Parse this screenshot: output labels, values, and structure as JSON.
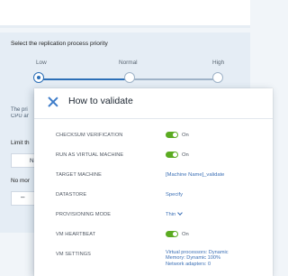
{
  "priority": {
    "title": "Select the replication process priority",
    "levels": [
      "Low",
      "Normal",
      "High"
    ],
    "selected": "Low"
  },
  "background": {
    "text_line1": "The pri",
    "text_line2": "CPU an",
    "limit_label": "Limit th",
    "field_value": "No",
    "no_more_label": "No mor",
    "stepper_symbol": "–"
  },
  "modal": {
    "title": "How to validate",
    "rows": {
      "checksum": {
        "label": "CHECKSUM VERIFICATION",
        "value": "On"
      },
      "run_vm": {
        "label": "RUN AS VIRTUAL MACHINE",
        "value": "On"
      },
      "target": {
        "label": "TARGET MACHINE",
        "value": "[Machine Name]_validate"
      },
      "datastore": {
        "label": "DATASTORE",
        "value": "Specify"
      },
      "provisioning": {
        "label": "PROVISIONING MODE",
        "value": "Thin"
      },
      "heartbeat": {
        "label": "VM HEARTBEAT",
        "value": "On"
      },
      "settings": {
        "label": "VM SETTINGS",
        "line1": "Virtual processors: Dynamic",
        "line2": "Memory: Dynamic 100%",
        "line3": "Network adapters: 0"
      }
    }
  },
  "colors": {
    "accent": "#3b6fb5",
    "toggle_on": "#5bab21"
  }
}
